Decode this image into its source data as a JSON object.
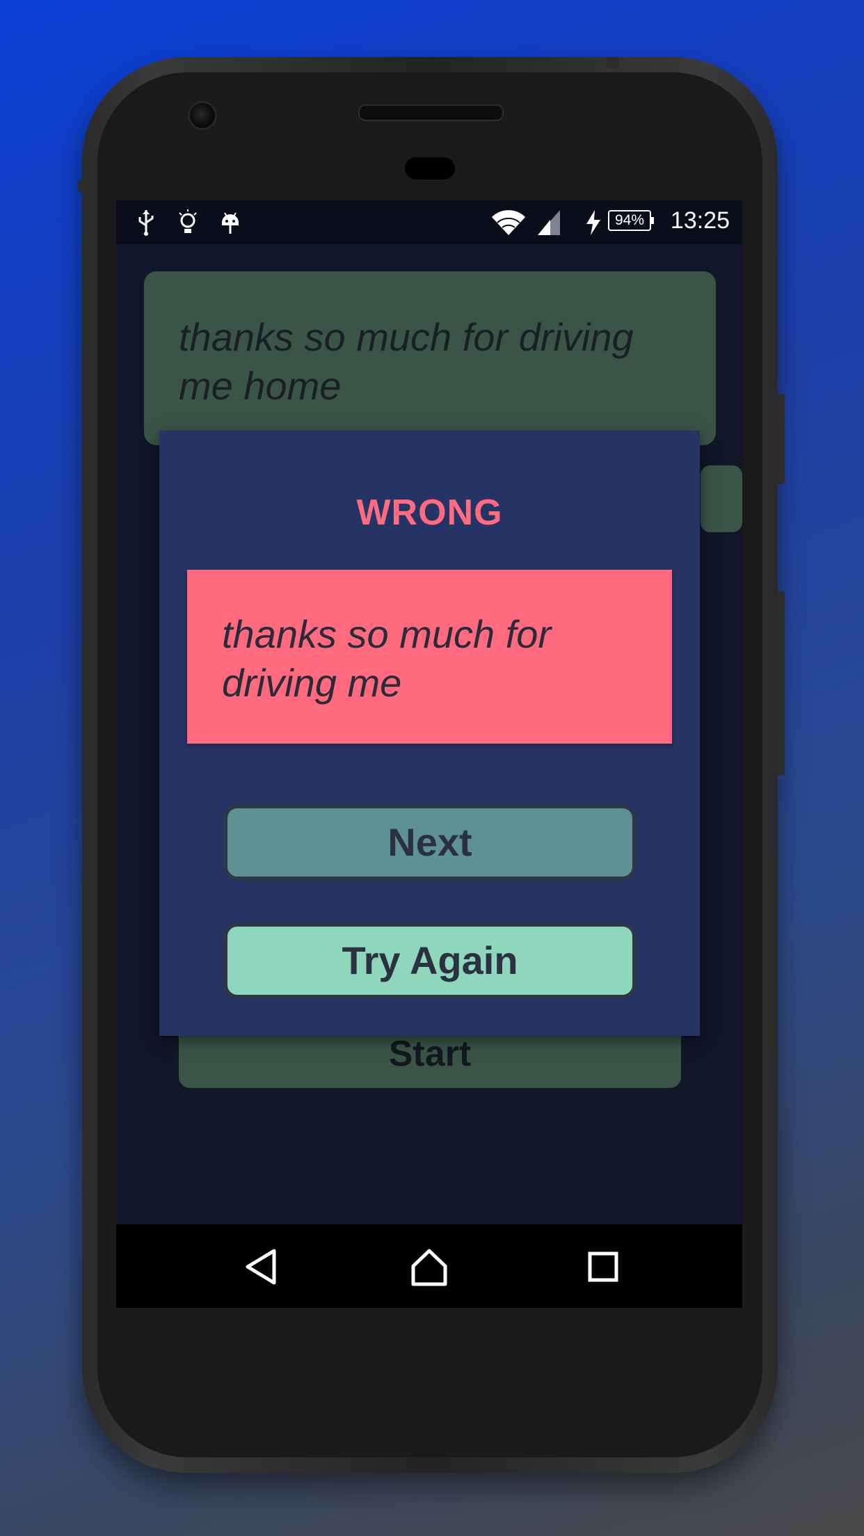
{
  "status_bar": {
    "left_icons": [
      "usb-icon",
      "lightbulb-icon",
      "android-debug-icon"
    ],
    "right_icons": [
      "wifi-icon",
      "cell-signal-icon",
      "charging-bolt-icon"
    ],
    "battery": "94%",
    "time": "13:25"
  },
  "background": {
    "phrase_card_text": "thanks so much for driving me home",
    "start_button": "Start"
  },
  "dialog": {
    "title": "WRONG",
    "answer_text": "thanks so much for driving me",
    "next_button": "Next",
    "try_again_button": "Try Again"
  },
  "nav_bar": {
    "icons": [
      "back-icon",
      "home-icon",
      "recents-icon"
    ]
  },
  "colors": {
    "app_background": "#111628",
    "card_green": "#3a5548",
    "dialog_background": "#253465",
    "wrong_pink": "#ff6c81",
    "answer_box": "#ff6a7e",
    "next_button": "#5e9193",
    "try_again_button": "#8ed7bc"
  }
}
